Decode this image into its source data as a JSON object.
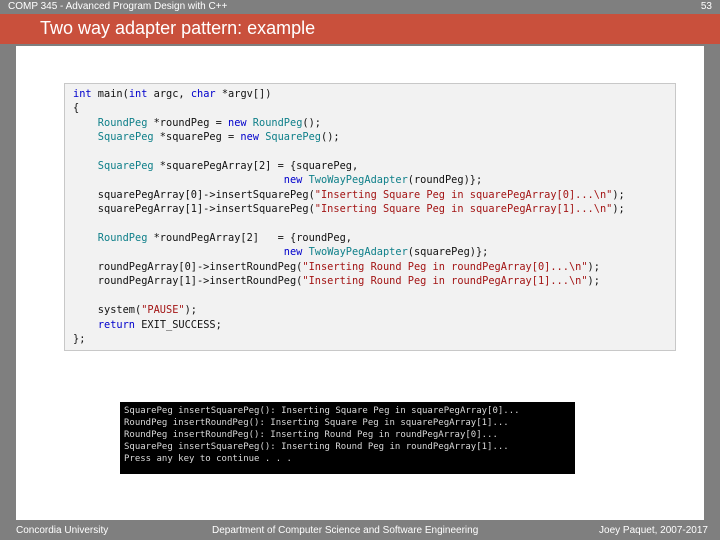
{
  "header": {
    "course": "COMP 345 - Advanced Program Design with C++",
    "page_number": "53",
    "title": "Two way adapter pattern: example"
  },
  "code_lines": [
    [
      {
        "t": "int",
        "c": "kw"
      },
      {
        "t": " main(",
        "c": "plain"
      },
      {
        "t": "int",
        "c": "kw"
      },
      {
        "t": " argc, ",
        "c": "plain"
      },
      {
        "t": "char",
        "c": "kw"
      },
      {
        "t": " *argv[])",
        "c": "plain"
      }
    ],
    [
      {
        "t": "{",
        "c": "plain"
      }
    ],
    [
      {
        "t": "    RoundPeg",
        "c": "cls"
      },
      {
        "t": " *roundPeg = ",
        "c": "plain"
      },
      {
        "t": "new",
        "c": "kw"
      },
      {
        "t": " RoundPeg",
        "c": "cls"
      },
      {
        "t": "();",
        "c": "plain"
      }
    ],
    [
      {
        "t": "    SquarePeg",
        "c": "cls"
      },
      {
        "t": " *squarePeg = ",
        "c": "plain"
      },
      {
        "t": "new",
        "c": "kw"
      },
      {
        "t": " SquarePeg",
        "c": "cls"
      },
      {
        "t": "();",
        "c": "plain"
      }
    ],
    [],
    [
      {
        "t": "    SquarePeg",
        "c": "cls"
      },
      {
        "t": " *squarePegArray[2] = {squarePeg,",
        "c": "plain"
      }
    ],
    [
      {
        "t": "                                  ",
        "c": "plain"
      },
      {
        "t": "new",
        "c": "kw"
      },
      {
        "t": " TwoWayPegAdapter",
        "c": "cls"
      },
      {
        "t": "(roundPeg)};",
        "c": "plain"
      }
    ],
    [
      {
        "t": "    squarePegArray[0]->insertSquarePeg(",
        "c": "plain"
      },
      {
        "t": "\"Inserting Square Peg in squarePegArray[0]...\\n\"",
        "c": "str"
      },
      {
        "t": ");",
        "c": "plain"
      }
    ],
    [
      {
        "t": "    squarePegArray[1]->insertSquarePeg(",
        "c": "plain"
      },
      {
        "t": "\"Inserting Square Peg in squarePegArray[1]...\\n\"",
        "c": "str"
      },
      {
        "t": ");",
        "c": "plain"
      }
    ],
    [],
    [
      {
        "t": "    RoundPeg",
        "c": "cls"
      },
      {
        "t": " *roundPegArray[2]   = {roundPeg,",
        "c": "plain"
      }
    ],
    [
      {
        "t": "                                  ",
        "c": "plain"
      },
      {
        "t": "new",
        "c": "kw"
      },
      {
        "t": " TwoWayPegAdapter",
        "c": "cls"
      },
      {
        "t": "(squarePeg)};",
        "c": "plain"
      }
    ],
    [
      {
        "t": "    roundPegArray[0]->insertRoundPeg(",
        "c": "plain"
      },
      {
        "t": "\"Inserting Round Peg in roundPegArray[0]...\\n\"",
        "c": "str"
      },
      {
        "t": ");",
        "c": "plain"
      }
    ],
    [
      {
        "t": "    roundPegArray[1]->insertRoundPeg(",
        "c": "plain"
      },
      {
        "t": "\"Inserting Round Peg in roundPegArray[1]...\\n\"",
        "c": "str"
      },
      {
        "t": ");",
        "c": "plain"
      }
    ],
    [],
    [
      {
        "t": "    system(",
        "c": "plain"
      },
      {
        "t": "\"PAUSE\"",
        "c": "str"
      },
      {
        "t": ");",
        "c": "plain"
      }
    ],
    [
      {
        "t": "    ",
        "c": "plain"
      },
      {
        "t": "return",
        "c": "kw"
      },
      {
        "t": " EXIT_SUCCESS;",
        "c": "plain"
      }
    ],
    [
      {
        "t": "};",
        "c": "plain"
      }
    ]
  ],
  "console_lines": [
    "SquarePeg insertSquarePeg(): Inserting Square Peg in squarePegArray[0]...",
    "RoundPeg insertRoundPeg(): Inserting Square Peg in squarePegArray[1]...",
    "RoundPeg insertRoundPeg(): Inserting Round Peg in roundPegArray[0]...",
    "SquarePeg insertSquarePeg(): Inserting Round Peg in roundPegArray[1]...",
    "Press any key to continue . . ."
  ],
  "footer": {
    "left": "Concordia University",
    "center": "Department of Computer Science and Software Engineering",
    "right": "Joey Paquet, 2007-2017"
  },
  "colors": {
    "background": "#7f7f7f",
    "title_bar": "#c9503c",
    "keyword": "#0000cc",
    "class_name": "#10808a",
    "string": "#a31515"
  }
}
